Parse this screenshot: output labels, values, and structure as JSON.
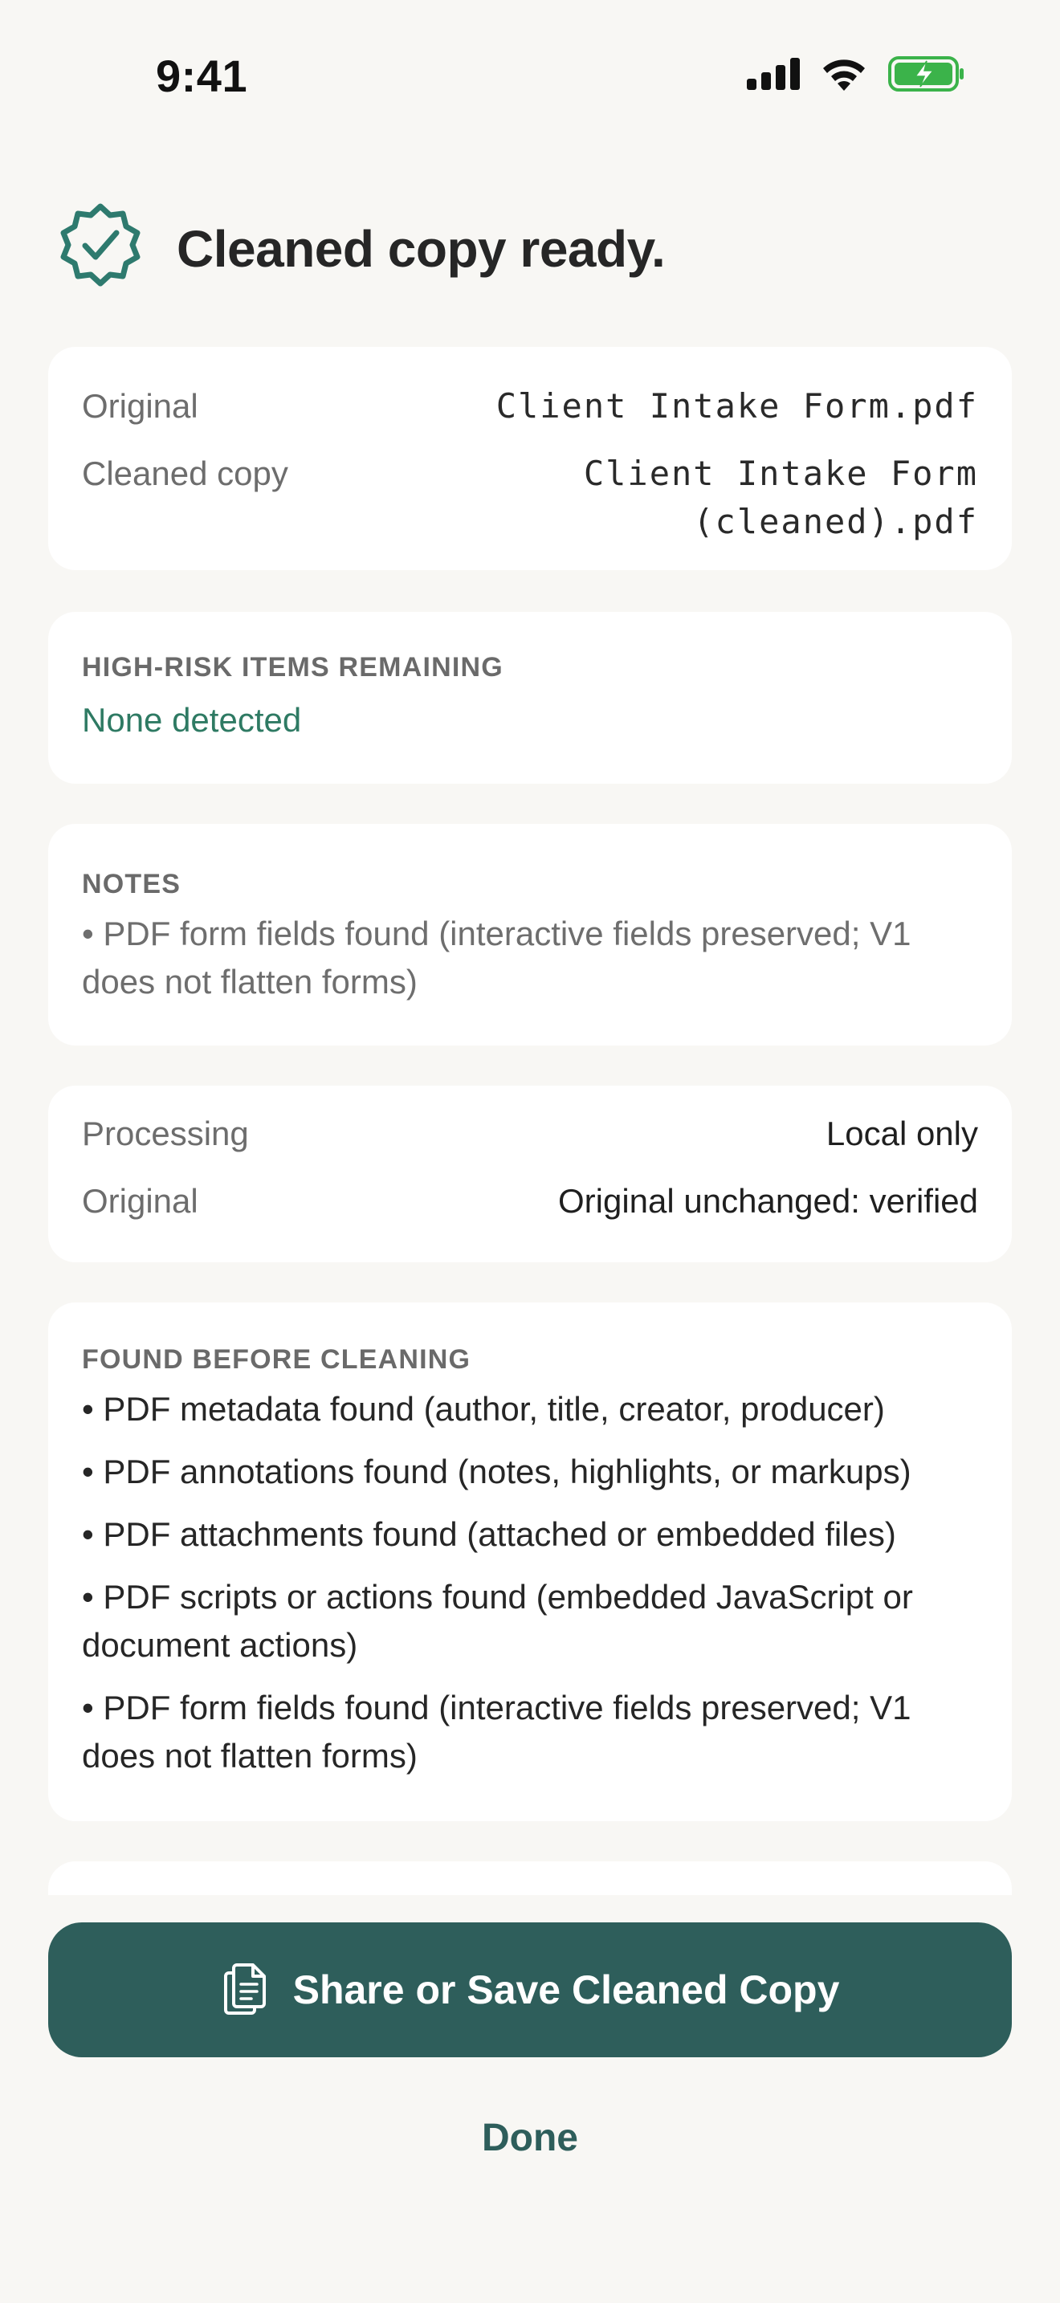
{
  "status_bar": {
    "time": "9:41",
    "icons": [
      "cellular-signal-icon",
      "wifi-icon",
      "battery-charging-icon"
    ]
  },
  "header": {
    "title": "Cleaned copy ready.",
    "icon": "verified-badge-icon"
  },
  "files": {
    "original_label": "Original",
    "original_value": "Client Intake Form.pdf",
    "cleaned_label": "Cleaned copy",
    "cleaned_value_line1": "Client Intake Form",
    "cleaned_value_line2": "(cleaned).pdf"
  },
  "high_risk": {
    "label": "HIGH-RISK ITEMS REMAINING",
    "value": "None detected"
  },
  "notes": {
    "label": "NOTES",
    "items": [
      "• PDF form fields found (interactive fields preserved; V1 does not flatten forms)"
    ]
  },
  "processing": {
    "processing_label": "Processing",
    "processing_value": "Local only",
    "original_label": "Original",
    "original_value": "Original unchanged: verified"
  },
  "found_before": {
    "label": "FOUND BEFORE CLEANING",
    "items": [
      "• PDF metadata found (author, title, creator, producer)",
      "• PDF annotations found (notes, highlights, or markups)",
      "• PDF attachments found (attached or embedded files)",
      "• PDF scripts or actions found (embedded JavaScript or document actions)",
      "• PDF form fields found (interactive fields preserved; V1 does not flatten forms)"
    ]
  },
  "actions": {
    "share_label": "Share or Save Cleaned Copy",
    "share_icon": "documents-icon",
    "done_label": "Done"
  },
  "colors": {
    "accent": "#2E5E5B",
    "success": "#2E7A63",
    "background": "#F8F7F4",
    "card": "#FFFFFF"
  }
}
